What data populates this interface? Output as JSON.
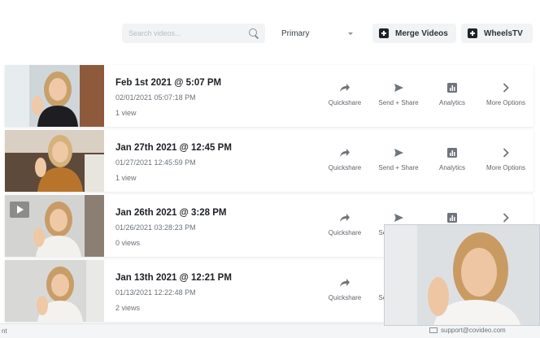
{
  "toolbar": {
    "search_placeholder": "Search videos...",
    "filter_value": "Primary",
    "merge_label": "Merge Videos",
    "wheels_label": "WheelsTV"
  },
  "actions": {
    "quickshare": "Quickshare",
    "send_share": "Send + Share",
    "analytics": "Analytics",
    "more": "More Options"
  },
  "videos": [
    {
      "title": "Feb 1st 2021 @ 5:07 PM",
      "datetime": "02/01/2021 05:07:18 PM",
      "views": "1 view"
    },
    {
      "title": "Jan 27th 2021 @ 12:45 PM",
      "datetime": "01/27/2021 12:45:59 PM",
      "views": "1 view"
    },
    {
      "title": "Jan 26th 2021 @ 3:28 PM",
      "datetime": "01/26/2021 03:28:23 PM",
      "views": "0 views"
    },
    {
      "title": "Jan 13th 2021 @ 12:21 PM",
      "datetime": "01/13/2021 12:22:48 PM",
      "views": "2 views"
    }
  ],
  "statusbar": {
    "left_text": "nt",
    "support_email": "support@covideo.com"
  },
  "colors": {
    "accent_dark": "#1f2226",
    "button_bg": "#f1f3f5",
    "text_muted": "#6b7177"
  }
}
